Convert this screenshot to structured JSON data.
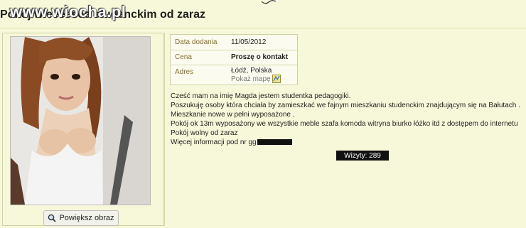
{
  "header": {
    "title": "Pokój wieeeeeee studenckim od zaraz",
    "watermark": "www.wiocha.pl"
  },
  "photo_panel": {
    "enlarge_label": "Powiększ obraz"
  },
  "details": {
    "rows": [
      {
        "label": "Data dodania",
        "value": "11/05/2012"
      },
      {
        "label": "Cena",
        "value": "Proszę o kontakt"
      },
      {
        "label": "Adres",
        "value": "Łódź, Polska"
      }
    ],
    "map_link": "Pokaż mapę"
  },
  "description": {
    "lines": [
      "Cześć mam na imię Magda jestem studentka pedagogiki.",
      "Poszukuję osoby która chciała by zamieszkać we fajnym mieszkaniu studenckim znajdującym się na Bałutach .",
      "Mieszkanie nowe w pełni wyposażone .",
      "Pokój ok 13m wyposażony we wszystkie meble szafa komoda witryna biurko łóżko itd z dostępem do internetu",
      "Pokój wolny od zaraz",
      "Więcej informacji pod nr gg"
    ]
  },
  "stats": {
    "visits": "Wizyty: 289"
  },
  "colors": {
    "background": "#f7f8d9",
    "border": "#cfd3a2",
    "label": "#8a6d2a",
    "badge": "#111111"
  }
}
